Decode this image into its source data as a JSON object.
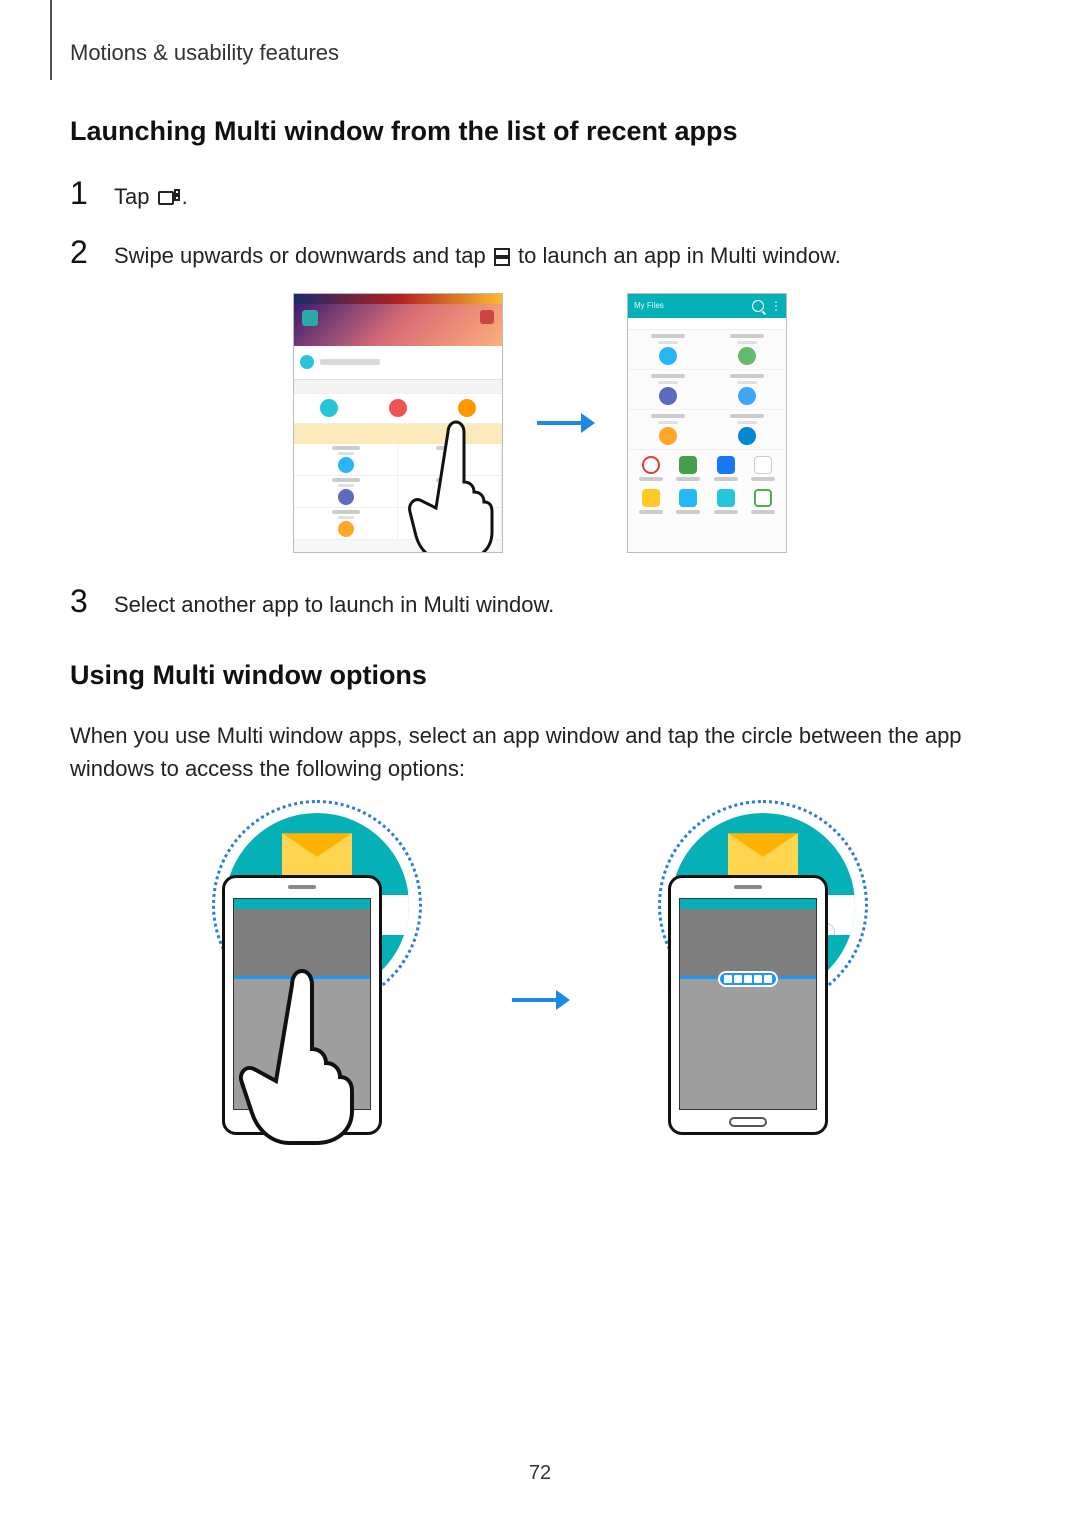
{
  "header": {
    "section": "Motions & usability features"
  },
  "section1": {
    "heading": "Launching Multi window from the list of recent apps",
    "steps": {
      "s1": {
        "num": "1",
        "pre": "Tap",
        "post": "."
      },
      "s2": {
        "num": "2",
        "pre": "Swipe upwards or downwards and tap",
        "post": " to launch an app in Multi window."
      },
      "s3": {
        "num": "3",
        "text": "Select another app to launch in Multi window."
      }
    }
  },
  "section2": {
    "heading": "Using Multi window options",
    "para": "When you use Multi window apps, select an app window and tap the circle between the app windows to access the following options:"
  },
  "page_number": "72"
}
